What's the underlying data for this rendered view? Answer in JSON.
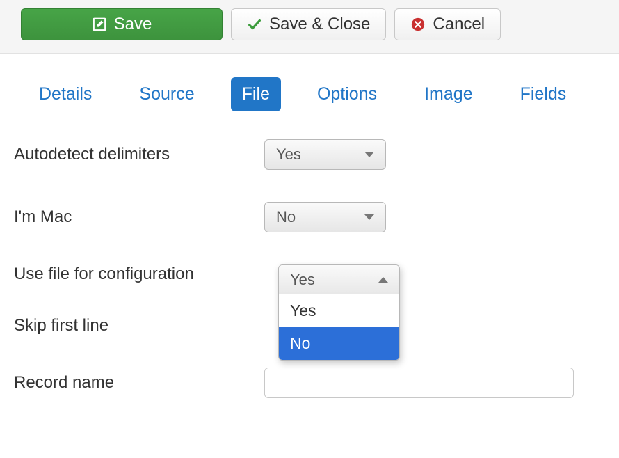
{
  "toolbar": {
    "save_label": "Save",
    "save_close_label": "Save & Close",
    "cancel_label": "Cancel"
  },
  "tabs": {
    "items": [
      "Details",
      "Source",
      "File",
      "Options",
      "Image",
      "Fields"
    ],
    "active_index": 2
  },
  "form": {
    "autodetect": {
      "label": "Autodetect delimiters",
      "value": "Yes"
    },
    "im_mac": {
      "label": "I'm Mac",
      "value": "No"
    },
    "use_file": {
      "label": "Use file for configuration",
      "open_display": "Yes",
      "options": [
        "Yes",
        "No"
      ],
      "highlight_index": 1
    },
    "skip_first": {
      "label": "Skip first line"
    },
    "record_name": {
      "label": "Record name",
      "value": ""
    }
  }
}
